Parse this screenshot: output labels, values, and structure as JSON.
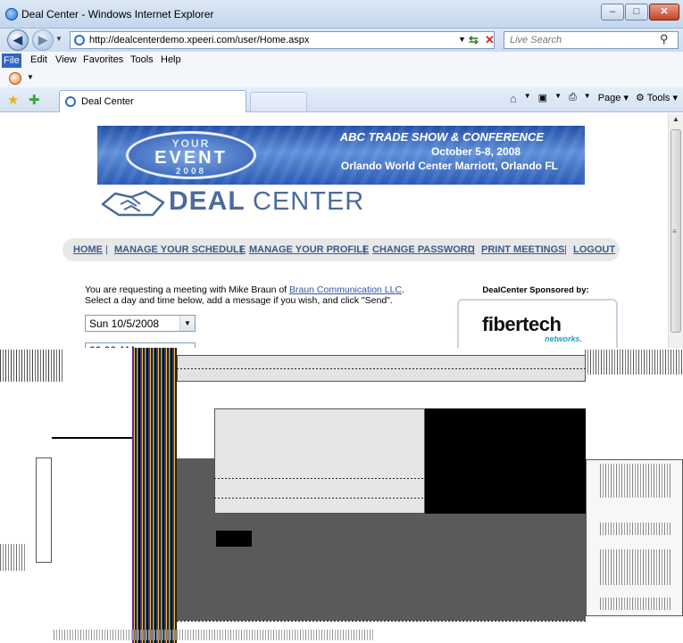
{
  "window": {
    "title": "Deal Center - Windows Internet Explorer",
    "minimize": "–",
    "maximize": "□",
    "close": "✕"
  },
  "address": {
    "url": "http://dealcenterdemo.xpeeri.com/user/Home.aspx",
    "search_placeholder": "Live Search"
  },
  "menu": [
    "File",
    "Edit",
    "View",
    "Favorites",
    "Tools",
    "Help"
  ],
  "tab": {
    "label": "Deal Center"
  },
  "commands": {
    "page": "Page",
    "tools": "Tools"
  },
  "banner": {
    "badge_top": "YOUR",
    "badge_mid": "EVENT",
    "badge_bottom": "2008",
    "line1": "ABC TRADE SHOW & CONFERENCE",
    "line2": "October 5-8, 2008",
    "line3": "Orlando World Center Marriott, Orlando FL"
  },
  "logo": {
    "bold": "DEAL",
    "light": "CENTER"
  },
  "nav": {
    "home": "HOME",
    "schedule": "MANAGE YOUR SCHEDULE",
    "profile": "MANAGE YOUR PROFILE",
    "password": "CHANGE PASSWORD",
    "print": "PRINT MEETINGS",
    "logout": "LOGOUT",
    "sep": "|"
  },
  "request": {
    "prefix": "You are requesting a meeting with  Mike Braun of ",
    "company": "Braun Communication LLC",
    "suffix": ".",
    "line2": "Select a day and time below, add a message if you wish, and click \"Send\"."
  },
  "form": {
    "day": "Sun 10/5/2008",
    "time": "00:00 AM"
  },
  "sponsor": {
    "title": "DealCenter Sponsored by:",
    "name": "fibertech",
    "sub": "networks."
  }
}
